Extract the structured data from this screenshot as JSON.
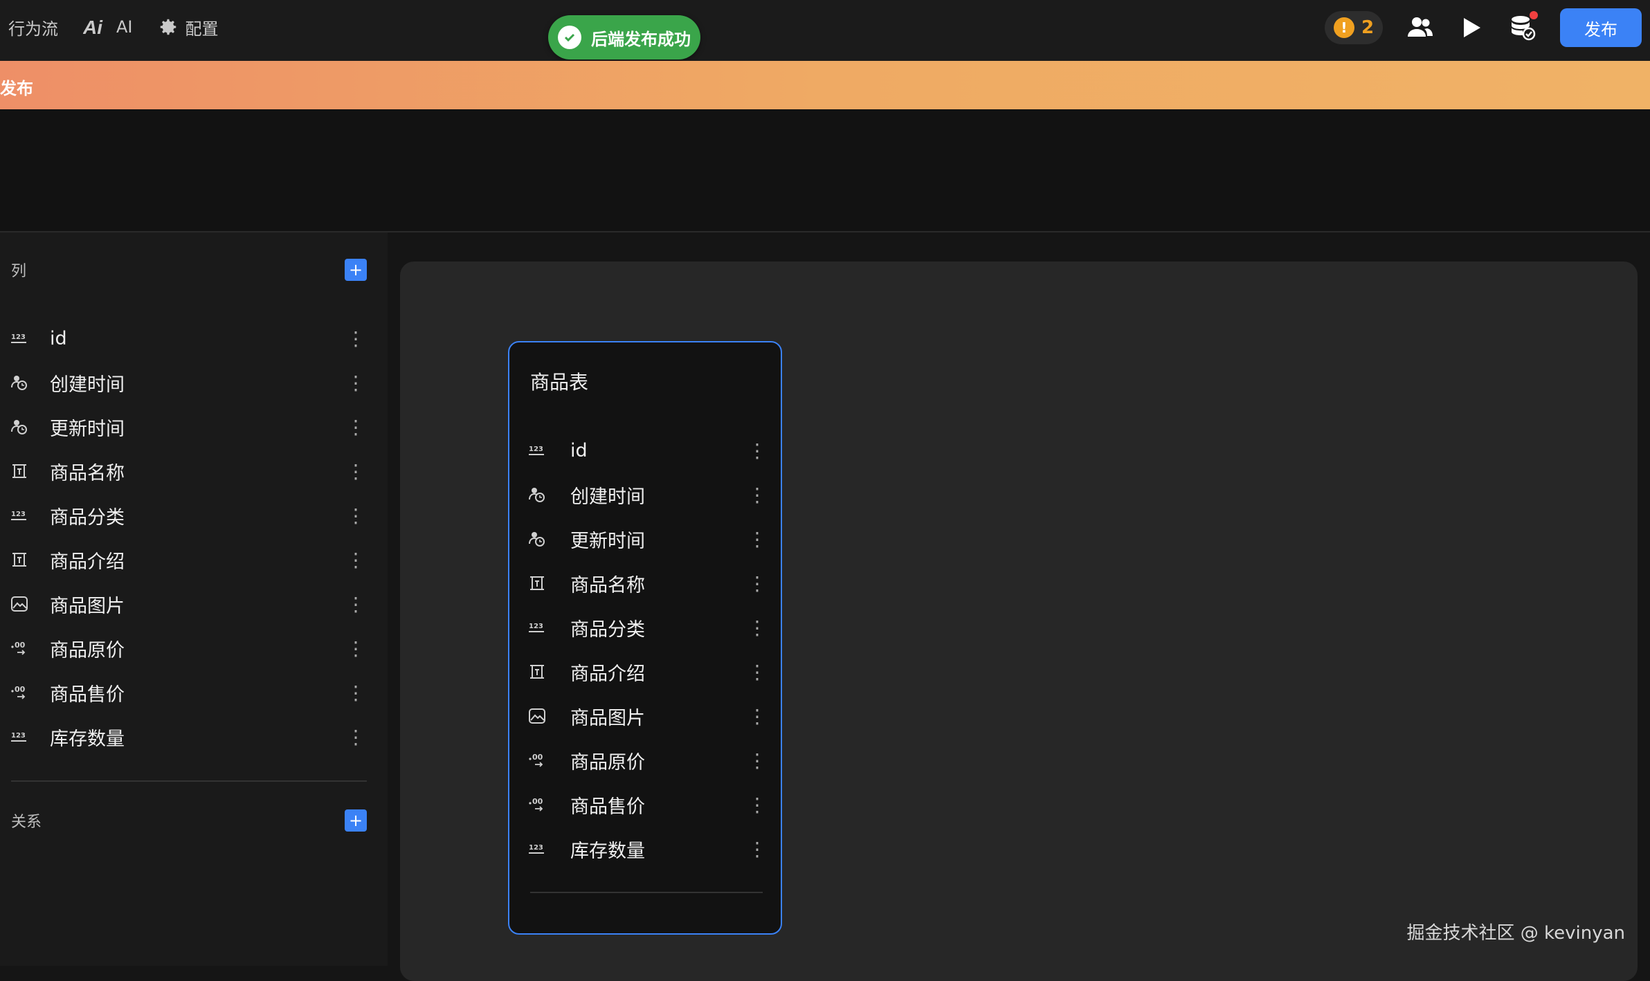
{
  "topbar": {
    "flow_label": "行为流",
    "ai_label": "AI",
    "config_label": "配置",
    "warning_count": "2",
    "publish_label": "发布"
  },
  "toast": {
    "message": "后端发布成功"
  },
  "banner": {
    "text": "发布"
  },
  "sidebar": {
    "columns_title": "列",
    "add_symbol": "+",
    "relations_title": "关系",
    "columns": [
      {
        "icon": "number-icon",
        "label": "id"
      },
      {
        "icon": "timestamp-icon",
        "label": "创建时间"
      },
      {
        "icon": "timestamp-icon",
        "label": "更新时间"
      },
      {
        "icon": "text-icon",
        "label": "商品名称"
      },
      {
        "icon": "number-icon",
        "label": "商品分类"
      },
      {
        "icon": "text-icon",
        "label": "商品介绍"
      },
      {
        "icon": "image-icon",
        "label": "商品图片"
      },
      {
        "icon": "decimal-icon",
        "label": "商品原价"
      },
      {
        "icon": "decimal-icon",
        "label": "商品售价"
      },
      {
        "icon": "number-icon",
        "label": "库存数量"
      }
    ]
  },
  "card": {
    "title": "商品表",
    "columns": [
      {
        "icon": "number-icon",
        "label": "id"
      },
      {
        "icon": "timestamp-icon",
        "label": "创建时间"
      },
      {
        "icon": "timestamp-icon",
        "label": "更新时间"
      },
      {
        "icon": "text-icon",
        "label": "商品名称"
      },
      {
        "icon": "number-icon",
        "label": "商品分类"
      },
      {
        "icon": "text-icon",
        "label": "商品介绍"
      },
      {
        "icon": "image-icon",
        "label": "商品图片"
      },
      {
        "icon": "decimal-icon",
        "label": "商品原价"
      },
      {
        "icon": "decimal-icon",
        "label": "商品售价"
      },
      {
        "icon": "number-icon",
        "label": "库存数量"
      }
    ]
  },
  "menu_glyph": "⋮",
  "watermark": "掘金技术社区 @ kevinyan",
  "colors": {
    "accent": "#3b82f6",
    "success": "#3aa54a",
    "warning": "#f0a020"
  }
}
